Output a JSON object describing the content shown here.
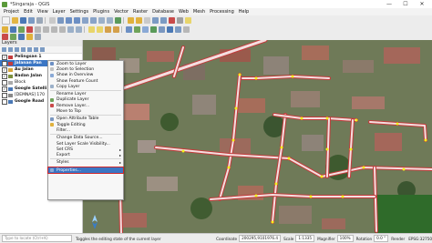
{
  "window": {
    "title": "*Singaraja - QGIS",
    "controls": [
      "—",
      "☐",
      "✕"
    ]
  },
  "menu": [
    "Project",
    "Edit",
    "View",
    "Layer",
    "Settings",
    "Plugins",
    "Vector",
    "Raster",
    "Database",
    "Web",
    "Mesh",
    "Processing",
    "Help"
  ],
  "layers_panel": {
    "title": "Layers",
    "layers": [
      {
        "name": "Pelingsan 1",
        "checked": true,
        "symbol_color": "#c43c3c",
        "bold": true,
        "selected": false
      },
      {
        "name": "Jalanan Pan",
        "checked": true,
        "symbol_color": "#c43c3c",
        "bold": true,
        "selected": true
      },
      {
        "name": "Au Jalan",
        "checked": true,
        "symbol_color": "#d6a63b",
        "bold": true,
        "selected": false
      },
      {
        "name": "Badan Jalan",
        "checked": true,
        "symbol_color": "#7b8f3e",
        "bold": true,
        "selected": false
      },
      {
        "name": "Block",
        "checked": false,
        "symbol_color": "#aaaaaa",
        "bold": false,
        "selected": false
      },
      {
        "name": "Google Satelli",
        "checked": true,
        "symbol_color": "#4a78b5",
        "bold": true,
        "selected": false
      },
      {
        "name": "[DEMNAS] 170",
        "checked": false,
        "symbol_color": "#888888",
        "bold": false,
        "selected": false
      },
      {
        "name": "Google Road",
        "checked": false,
        "symbol_color": "#4a78b5",
        "bold": true,
        "selected": false
      }
    ]
  },
  "context_menu": {
    "items": [
      {
        "label": "Zoom to Layer",
        "icon_color": "#6c8fc4",
        "separator_after": false,
        "submenu": false,
        "highlighted": false
      },
      {
        "label": "Zoom to Selection",
        "icon_color": "#c2c2c2",
        "separator_after": false,
        "submenu": false,
        "highlighted": false
      },
      {
        "label": "Show in Overview",
        "icon_color": "#8aa9d6",
        "separator_after": false,
        "submenu": false,
        "highlighted": false
      },
      {
        "label": "Show Feature Count",
        "icon_color": "#f7f7f7",
        "separator_after": false,
        "submenu": false,
        "highlighted": false
      },
      {
        "label": "Copy Layer",
        "icon_color": "#9bb0c9",
        "separator_after": true,
        "submenu": false,
        "highlighted": false
      },
      {
        "label": "Rename Layer",
        "icon_color": "#f7f7f7",
        "separator_after": false,
        "submenu": false,
        "highlighted": false
      },
      {
        "label": "Duplicate Layer",
        "icon_color": "#6fa35a",
        "separator_after": false,
        "submenu": false,
        "highlighted": false
      },
      {
        "label": "Remove Layer...",
        "icon_color": "#c94a4a",
        "separator_after": false,
        "submenu": false,
        "highlighted": false
      },
      {
        "label": "Move to Top",
        "icon_color": "#f7f7f7",
        "separator_after": true,
        "submenu": false,
        "highlighted": false
      },
      {
        "label": "Open Attribute Table",
        "icon_color": "#7a97c0",
        "separator_after": false,
        "submenu": false,
        "highlighted": false
      },
      {
        "label": "Toggle Editing",
        "icon_color": "#e0b13c",
        "separator_after": false,
        "submenu": false,
        "highlighted": false
      },
      {
        "label": "Filter...",
        "icon_color": "#f7f7f7",
        "separator_after": true,
        "submenu": false,
        "highlighted": false
      },
      {
        "label": "Change Data Source...",
        "icon_color": "#f7f7f7",
        "separator_after": false,
        "submenu": false,
        "highlighted": false
      },
      {
        "label": "Set Layer Scale Visibility...",
        "icon_color": "#f7f7f7",
        "separator_after": false,
        "submenu": false,
        "highlighted": false
      },
      {
        "label": "Set CRS",
        "icon_color": "#f7f7f7",
        "separator_after": false,
        "submenu": true,
        "highlighted": false
      },
      {
        "label": "Export",
        "icon_color": "#f7f7f7",
        "separator_after": true,
        "submenu": true,
        "highlighted": false
      },
      {
        "label": "Styles",
        "icon_color": "#f7f7f7",
        "separator_after": true,
        "submenu": true,
        "highlighted": false
      },
      {
        "label": "Properties...",
        "icon_color": "#8aa9d6",
        "separator_after": false,
        "submenu": false,
        "highlighted": true
      }
    ]
  },
  "statusbar": {
    "search_placeholder": "Type to locate (Ctrl+K)",
    "message": "Toggles the editing state of the current layer",
    "coordinate_label": "Coordinate",
    "coordinate": "200295,9101976.4",
    "scale_label": "Scale",
    "scale": "1:1335",
    "magnifier_label": "Magnifier",
    "magnifier": "100%",
    "rotation_label": "Rotation",
    "rotation": "0.0 °",
    "render_label": "Render",
    "crs": "EPSG:32750"
  },
  "colors": {
    "accent": "#3b76c4",
    "highlight_outline": "#d0262b",
    "road": "#f3dfe0",
    "road_edge": "#c23b3b",
    "vertex": "#f2f21a"
  }
}
